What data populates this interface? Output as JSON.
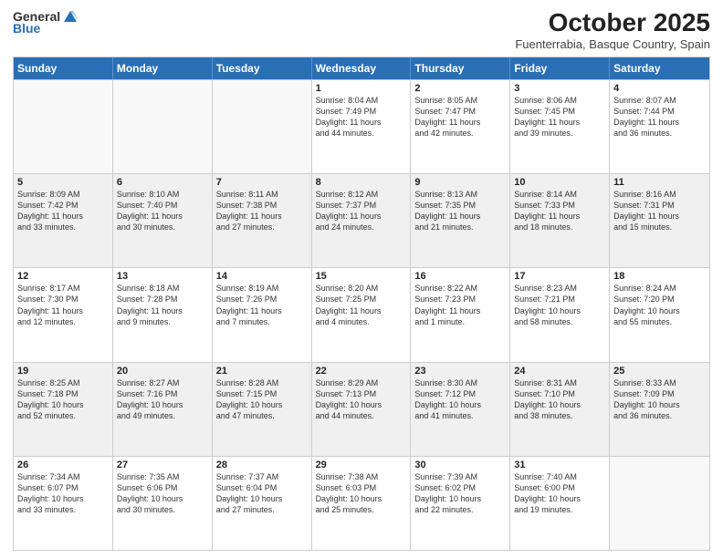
{
  "header": {
    "logo_general": "General",
    "logo_blue": "Blue",
    "title": "October 2025",
    "location": "Fuenterrabia, Basque Country, Spain"
  },
  "days_of_week": [
    "Sunday",
    "Monday",
    "Tuesday",
    "Wednesday",
    "Thursday",
    "Friday",
    "Saturday"
  ],
  "rows": [
    [
      {
        "day": "",
        "text": ""
      },
      {
        "day": "",
        "text": ""
      },
      {
        "day": "",
        "text": ""
      },
      {
        "day": "1",
        "text": "Sunrise: 8:04 AM\nSunset: 7:49 PM\nDaylight: 11 hours\nand 44 minutes."
      },
      {
        "day": "2",
        "text": "Sunrise: 8:05 AM\nSunset: 7:47 PM\nDaylight: 11 hours\nand 42 minutes."
      },
      {
        "day": "3",
        "text": "Sunrise: 8:06 AM\nSunset: 7:45 PM\nDaylight: 11 hours\nand 39 minutes."
      },
      {
        "day": "4",
        "text": "Sunrise: 8:07 AM\nSunset: 7:44 PM\nDaylight: 11 hours\nand 36 minutes."
      }
    ],
    [
      {
        "day": "5",
        "text": "Sunrise: 8:09 AM\nSunset: 7:42 PM\nDaylight: 11 hours\nand 33 minutes."
      },
      {
        "day": "6",
        "text": "Sunrise: 8:10 AM\nSunset: 7:40 PM\nDaylight: 11 hours\nand 30 minutes."
      },
      {
        "day": "7",
        "text": "Sunrise: 8:11 AM\nSunset: 7:38 PM\nDaylight: 11 hours\nand 27 minutes."
      },
      {
        "day": "8",
        "text": "Sunrise: 8:12 AM\nSunset: 7:37 PM\nDaylight: 11 hours\nand 24 minutes."
      },
      {
        "day": "9",
        "text": "Sunrise: 8:13 AM\nSunset: 7:35 PM\nDaylight: 11 hours\nand 21 minutes."
      },
      {
        "day": "10",
        "text": "Sunrise: 8:14 AM\nSunset: 7:33 PM\nDaylight: 11 hours\nand 18 minutes."
      },
      {
        "day": "11",
        "text": "Sunrise: 8:16 AM\nSunset: 7:31 PM\nDaylight: 11 hours\nand 15 minutes."
      }
    ],
    [
      {
        "day": "12",
        "text": "Sunrise: 8:17 AM\nSunset: 7:30 PM\nDaylight: 11 hours\nand 12 minutes."
      },
      {
        "day": "13",
        "text": "Sunrise: 8:18 AM\nSunset: 7:28 PM\nDaylight: 11 hours\nand 9 minutes."
      },
      {
        "day": "14",
        "text": "Sunrise: 8:19 AM\nSunset: 7:26 PM\nDaylight: 11 hours\nand 7 minutes."
      },
      {
        "day": "15",
        "text": "Sunrise: 8:20 AM\nSunset: 7:25 PM\nDaylight: 11 hours\nand 4 minutes."
      },
      {
        "day": "16",
        "text": "Sunrise: 8:22 AM\nSunset: 7:23 PM\nDaylight: 11 hours\nand 1 minute."
      },
      {
        "day": "17",
        "text": "Sunrise: 8:23 AM\nSunset: 7:21 PM\nDaylight: 10 hours\nand 58 minutes."
      },
      {
        "day": "18",
        "text": "Sunrise: 8:24 AM\nSunset: 7:20 PM\nDaylight: 10 hours\nand 55 minutes."
      }
    ],
    [
      {
        "day": "19",
        "text": "Sunrise: 8:25 AM\nSunset: 7:18 PM\nDaylight: 10 hours\nand 52 minutes."
      },
      {
        "day": "20",
        "text": "Sunrise: 8:27 AM\nSunset: 7:16 PM\nDaylight: 10 hours\nand 49 minutes."
      },
      {
        "day": "21",
        "text": "Sunrise: 8:28 AM\nSunset: 7:15 PM\nDaylight: 10 hours\nand 47 minutes."
      },
      {
        "day": "22",
        "text": "Sunrise: 8:29 AM\nSunset: 7:13 PM\nDaylight: 10 hours\nand 44 minutes."
      },
      {
        "day": "23",
        "text": "Sunrise: 8:30 AM\nSunset: 7:12 PM\nDaylight: 10 hours\nand 41 minutes."
      },
      {
        "day": "24",
        "text": "Sunrise: 8:31 AM\nSunset: 7:10 PM\nDaylight: 10 hours\nand 38 minutes."
      },
      {
        "day": "25",
        "text": "Sunrise: 8:33 AM\nSunset: 7:09 PM\nDaylight: 10 hours\nand 36 minutes."
      }
    ],
    [
      {
        "day": "26",
        "text": "Sunrise: 7:34 AM\nSunset: 6:07 PM\nDaylight: 10 hours\nand 33 minutes."
      },
      {
        "day": "27",
        "text": "Sunrise: 7:35 AM\nSunset: 6:06 PM\nDaylight: 10 hours\nand 30 minutes."
      },
      {
        "day": "28",
        "text": "Sunrise: 7:37 AM\nSunset: 6:04 PM\nDaylight: 10 hours\nand 27 minutes."
      },
      {
        "day": "29",
        "text": "Sunrise: 7:38 AM\nSunset: 6:03 PM\nDaylight: 10 hours\nand 25 minutes."
      },
      {
        "day": "30",
        "text": "Sunrise: 7:39 AM\nSunset: 6:02 PM\nDaylight: 10 hours\nand 22 minutes."
      },
      {
        "day": "31",
        "text": "Sunrise: 7:40 AM\nSunset: 6:00 PM\nDaylight: 10 hours\nand 19 minutes."
      },
      {
        "day": "",
        "text": ""
      }
    ]
  ],
  "shaded_rows": [
    1,
    3
  ]
}
